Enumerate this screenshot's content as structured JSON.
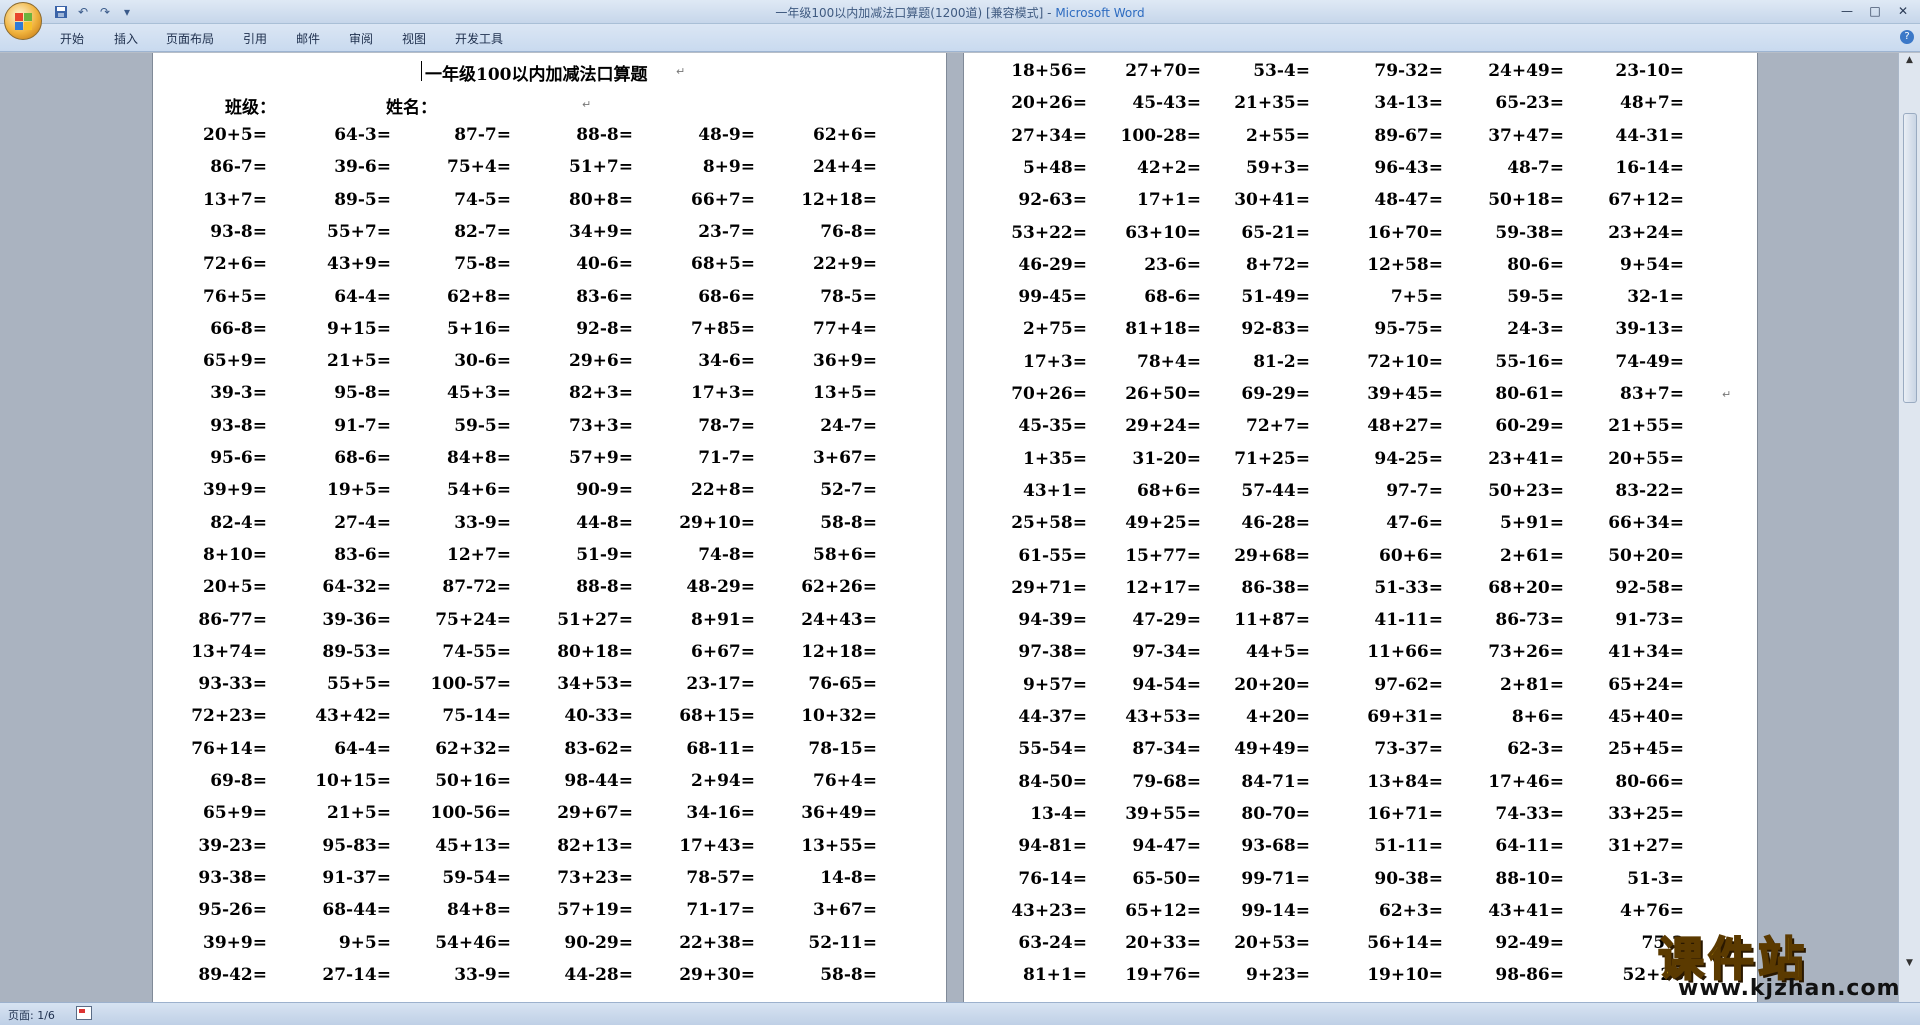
{
  "window": {
    "title": "一年级100以内加减法口算题(1200道) [兼容模式] - ",
    "app_name": "Microsoft Word"
  },
  "qat": {
    "save_icon": "save-icon",
    "undo_icon": "undo-icon",
    "redo_icon": "redo-icon",
    "more": "▾"
  },
  "controls": {
    "minimize": "—",
    "maximize": "□",
    "close": "✕"
  },
  "ribbon_tabs": [
    "开始",
    "插入",
    "页面布局",
    "引用",
    "邮件",
    "审阅",
    "视图",
    "开发工具"
  ],
  "help": "?",
  "document": {
    "title": "一年级100以内加减法口算题",
    "class_label": "班级：",
    "name_label": "姓名：",
    "return_mark": "↵"
  },
  "page1_rows": [
    [
      "20+5=",
      "64-3=",
      "87-7=",
      "88-8=",
      "48-9=",
      "62+6="
    ],
    [
      "86-7=",
      "39-6=",
      "75+4=",
      "51+7=",
      "8+9=",
      "24+4="
    ],
    [
      "13+7=",
      "89-5=",
      "74-5=",
      "80+8=",
      "66+7=",
      "12+18="
    ],
    [
      "93-8=",
      "55+7=",
      "82-7=",
      "34+9=",
      "23-7=",
      "76-8="
    ],
    [
      "72+6=",
      "43+9=",
      "75-8=",
      "40-6=",
      "68+5=",
      "22+9="
    ],
    [
      "76+5=",
      "64-4=",
      "62+8=",
      "83-6=",
      "68-6=",
      "78-5="
    ],
    [
      "66-8=",
      "9+15=",
      "5+16=",
      "92-8=",
      "7+85=",
      "77+4="
    ],
    [
      "65+9=",
      "21+5=",
      "30-6=",
      "29+6=",
      "34-6=",
      "36+9="
    ],
    [
      "39-3=",
      "95-8=",
      "45+3=",
      "82+3=",
      "17+3=",
      "13+5="
    ],
    [
      "93-8=",
      "91-7=",
      "59-5=",
      "73+3=",
      "78-7=",
      "24-7="
    ],
    [
      "95-6=",
      "68-6=",
      "84+8=",
      "57+9=",
      "71-7=",
      "3+67="
    ],
    [
      "39+9=",
      "19+5=",
      "54+6=",
      "90-9=",
      "22+8=",
      "52-7="
    ],
    [
      "82-4=",
      "27-4=",
      "33-9=",
      "44-8=",
      "29+10=",
      "58-8="
    ],
    [
      "8+10=",
      "83-6=",
      "12+7=",
      "51-9=",
      "74-8=",
      "58+6="
    ],
    [
      "20+5=",
      "64-32=",
      "87-72=",
      "88-8=",
      "48-29=",
      "62+26="
    ],
    [
      "86-77=",
      "39-36=",
      "75+24=",
      "51+27=",
      "8+91=",
      "24+43="
    ],
    [
      "13+74=",
      "89-53=",
      "74-55=",
      "80+18=",
      "6+67=",
      "12+18="
    ],
    [
      "93-33=",
      "55+5=",
      "100-57=",
      "34+53=",
      "23-17=",
      "76-65="
    ],
    [
      "72+23=",
      "43+42=",
      "75-14=",
      "40-33=",
      "68+15=",
      "10+32="
    ],
    [
      "76+14=",
      "64-4=",
      "62+32=",
      "83-62=",
      "68-11=",
      "78-15="
    ],
    [
      "69-8=",
      "10+15=",
      "50+16=",
      "98-44=",
      "2+94=",
      "76+4="
    ],
    [
      "65+9=",
      "21+5=",
      "100-56=",
      "29+67=",
      "34-16=",
      "36+49="
    ],
    [
      "39-23=",
      "95-83=",
      "45+13=",
      "82+13=",
      "17+43=",
      "13+55="
    ],
    [
      "93-38=",
      "91-37=",
      "59-54=",
      "73+23=",
      "78-57=",
      "14-8="
    ],
    [
      "95-26=",
      "68-44=",
      "84+8=",
      "57+19=",
      "71-17=",
      "3+67="
    ],
    [
      "39+9=",
      "9+5=",
      "54+46=",
      "90-29=",
      "22+38=",
      "52-11="
    ],
    [
      "89-42=",
      "27-14=",
      "33-9=",
      "44-28=",
      "29+30=",
      "58-8="
    ]
  ],
  "page2_rows": [
    [
      "18+56=",
      "27+70=",
      "53-4=",
      "79-32=",
      "24+49=",
      "23-10="
    ],
    [
      "20+26=",
      "45-43=",
      "21+35=",
      "34-13=",
      "65-23=",
      "48+7="
    ],
    [
      "27+34=",
      "100-28=",
      "2+55=",
      "89-67=",
      "37+47=",
      "44-31="
    ],
    [
      "5+48=",
      "42+2=",
      "59+3=",
      "96-43=",
      "48-7=",
      "16-14="
    ],
    [
      "92-63=",
      "17+1=",
      "30+41=",
      "48-47=",
      "50+18=",
      "67+12="
    ],
    [
      "53+22=",
      "63+10=",
      "65-21=",
      "16+70=",
      "59-38=",
      "23+24="
    ],
    [
      "46-29=",
      "23-6=",
      "8+72=",
      "12+58=",
      "80-6=",
      "9+54="
    ],
    [
      "99-45=",
      "68-6=",
      "51-49=",
      "7+5=",
      "59-5=",
      "32-1="
    ],
    [
      "2+75=",
      "81+18=",
      "92-83=",
      "95-75=",
      "24-3=",
      "39-13="
    ],
    [
      "17+3=",
      "78+4=",
      "81-2=",
      "72+10=",
      "55-16=",
      "74-49="
    ],
    [
      "70+26=",
      "26+50=",
      "69-29=",
      "39+45=",
      "80-61=",
      "83+7="
    ],
    [
      "45-35=",
      "29+24=",
      "72+7=",
      "48+27=",
      "60-29=",
      "21+55="
    ],
    [
      "1+35=",
      "31-20=",
      "71+25=",
      "94-25=",
      "23+41=",
      "20+55="
    ],
    [
      "43+1=",
      "68+6=",
      "57-44=",
      "97-7=",
      "50+23=",
      "83-22="
    ],
    [
      "25+58=",
      "49+25=",
      "46-28=",
      "47-6=",
      "5+91=",
      "66+34="
    ],
    [
      "61-55=",
      "15+77=",
      "29+68=",
      "60+6=",
      "2+61=",
      "50+20="
    ],
    [
      "29+71=",
      "12+17=",
      "86-38=",
      "51-33=",
      "68+20=",
      "92-58="
    ],
    [
      "94-39=",
      "47-29=",
      "11+87=",
      "41-11=",
      "86-73=",
      "91-73="
    ],
    [
      "97-38=",
      "97-34=",
      "44+5=",
      "11+66=",
      "73+26=",
      "41+34="
    ],
    [
      "9+57=",
      "94-54=",
      "20+20=",
      "97-62=",
      "2+81=",
      "65+24="
    ],
    [
      "44-37=",
      "43+53=",
      "4+20=",
      "69+31=",
      "8+6=",
      "45+40="
    ],
    [
      "55-54=",
      "87-34=",
      "49+49=",
      "73-37=",
      "62-3=",
      "25+45="
    ],
    [
      "84-50=",
      "79-68=",
      "84-71=",
      "13+84=",
      "17+46=",
      "80-66="
    ],
    [
      "13-4=",
      "39+55=",
      "80-70=",
      "16+71=",
      "74-33=",
      "33+25="
    ],
    [
      "94-81=",
      "94-47=",
      "93-68=",
      "51-11=",
      "64-11=",
      "31+27="
    ],
    [
      "76-14=",
      "65-50=",
      "99-71=",
      "90-38=",
      "88-10=",
      "51-3="
    ],
    [
      "43+23=",
      "65+12=",
      "99-14=",
      "62+3=",
      "43+41=",
      "4+76="
    ],
    [
      "63-24=",
      "20+33=",
      "20+53=",
      "56+14=",
      "92-49=",
      "75-2"
    ],
    [
      "81+1=",
      "19+76=",
      "9+23=",
      "19+10=",
      "98-86=",
      "52+28"
    ]
  ],
  "status": {
    "page": "页面: 1/6"
  },
  "watermark": {
    "text": "课件站",
    "url": "www.kjzhan.com"
  }
}
